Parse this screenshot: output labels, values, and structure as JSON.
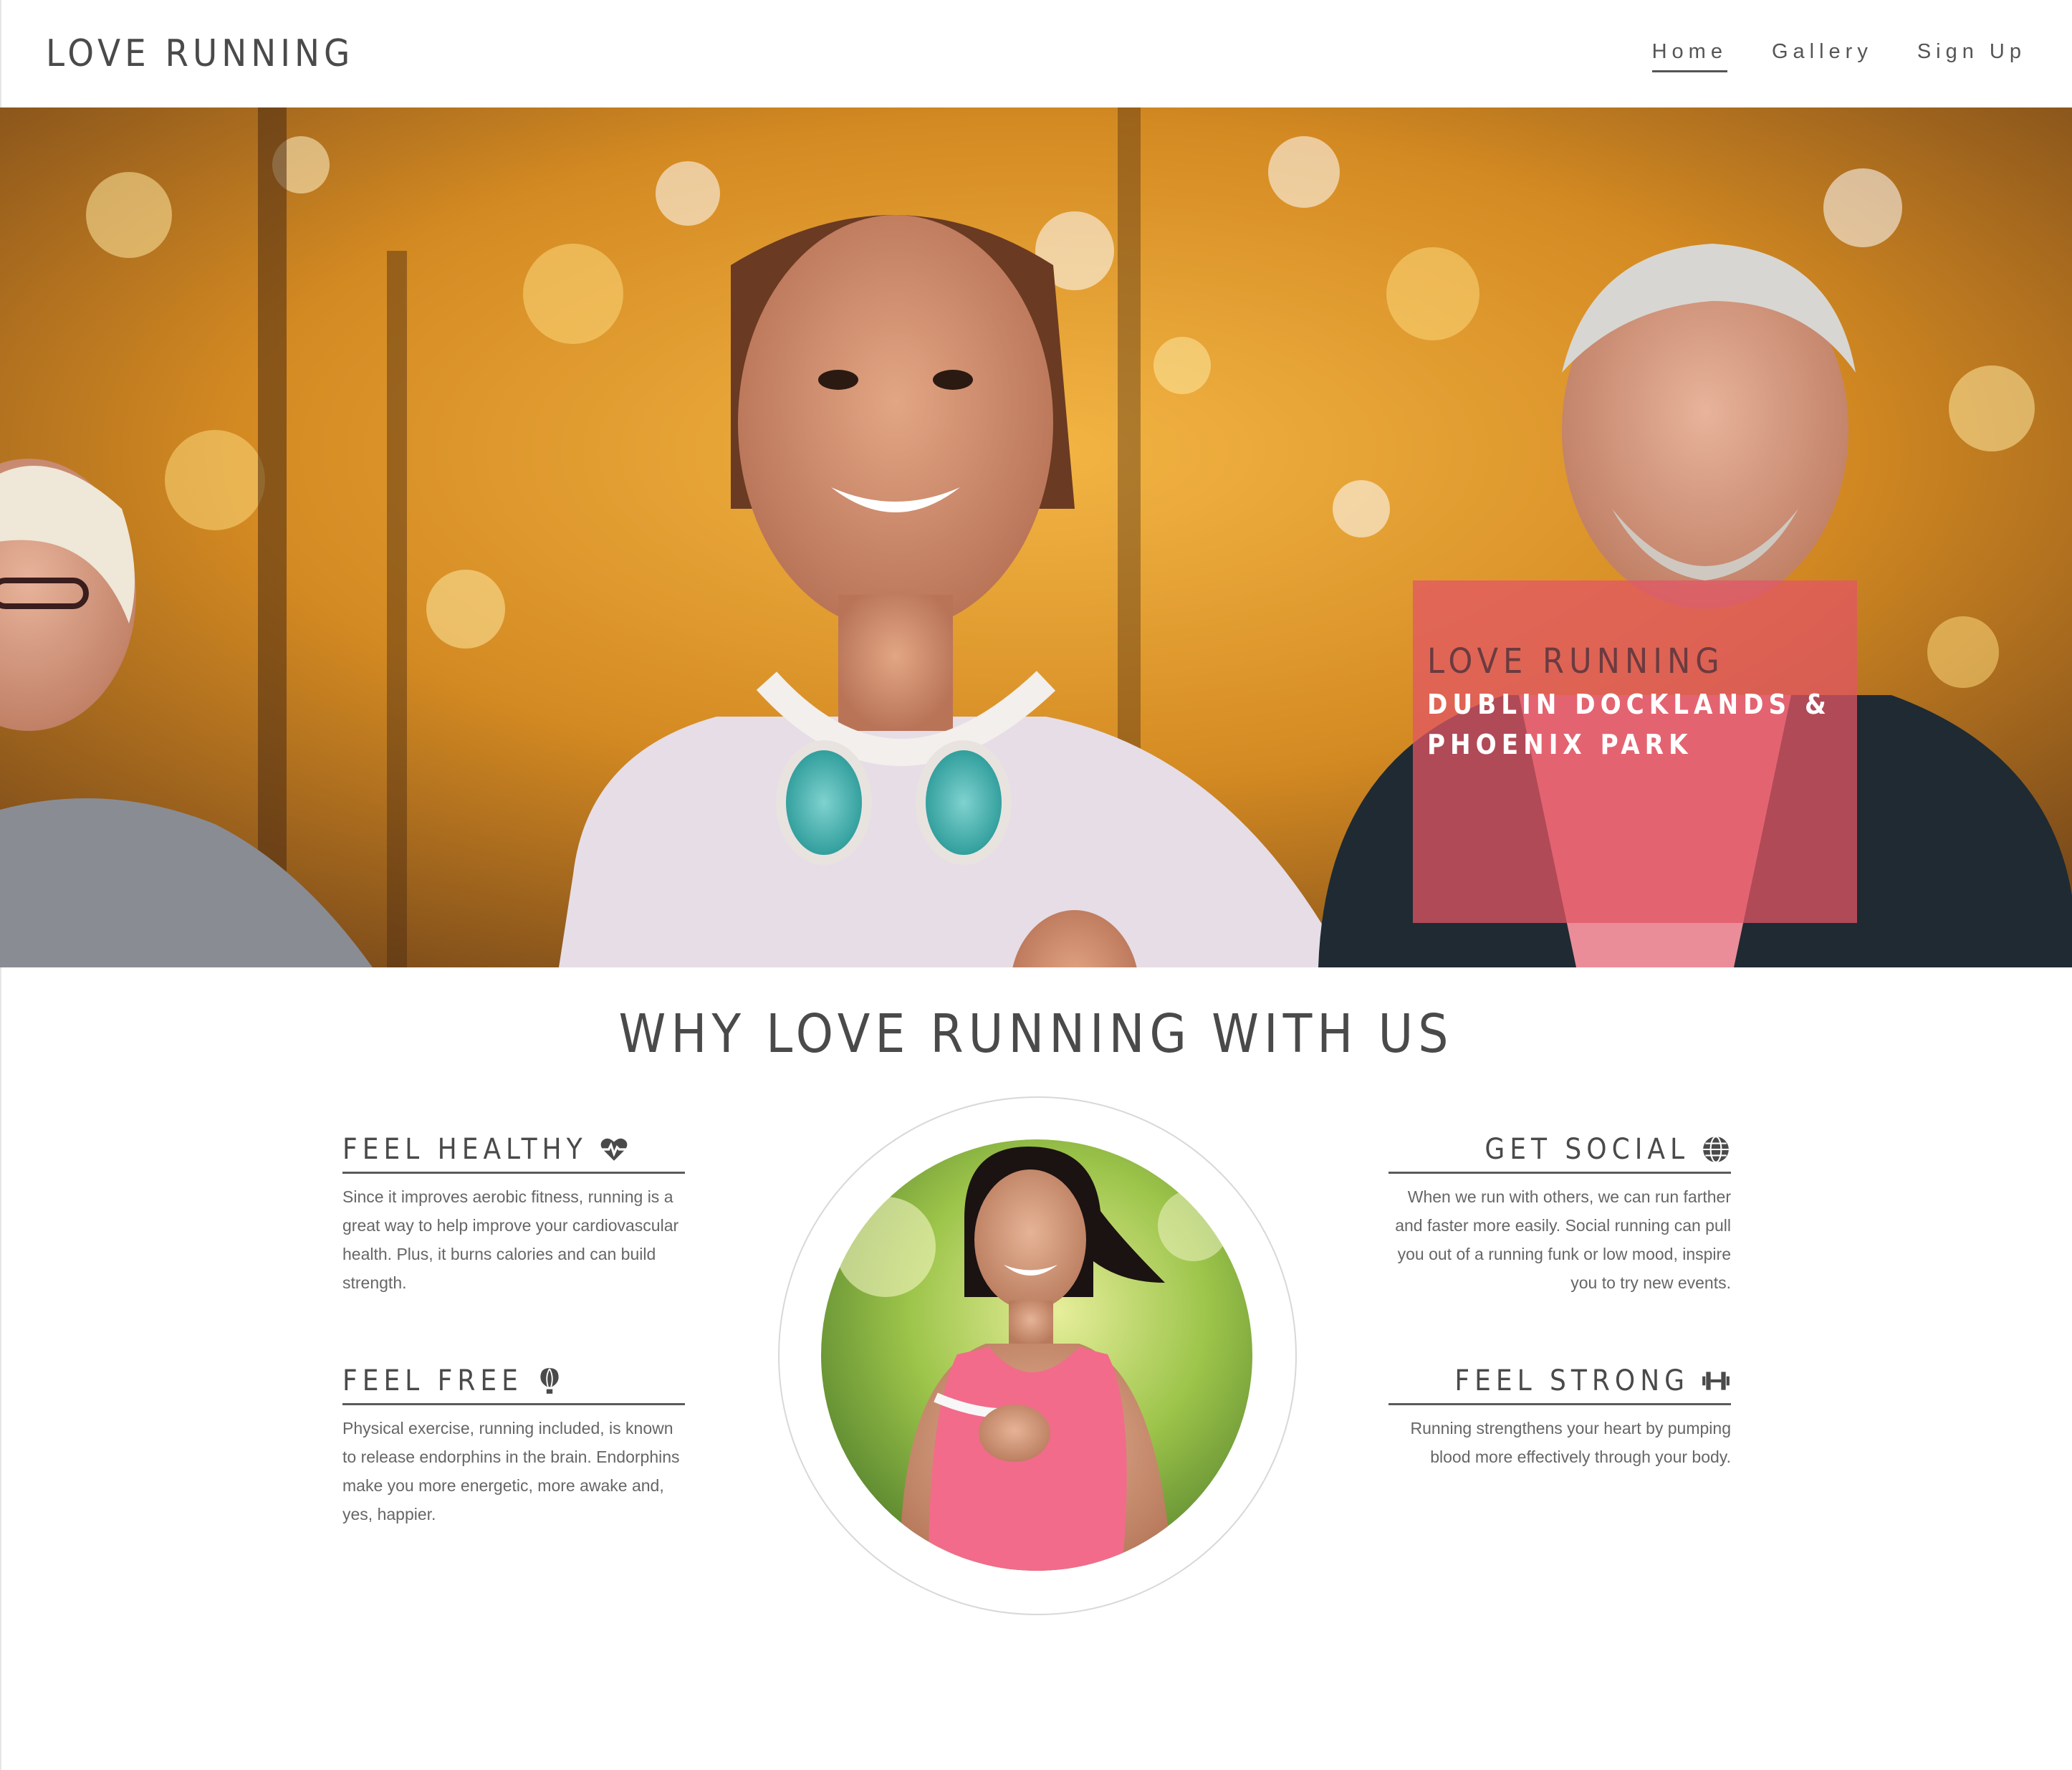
{
  "header": {
    "brand": "LOVE RUNNING",
    "nav": [
      {
        "label": "Home",
        "active": true
      },
      {
        "label": "Gallery",
        "active": false
      },
      {
        "label": "Sign Up",
        "active": false
      }
    ]
  },
  "hero": {
    "title": "LOVE RUNNING",
    "subtitle_line1": "DUBLIN DOCKLANDS &",
    "subtitle_line2": "PHOENIX PARK",
    "box_color": "#e25664"
  },
  "why": {
    "title": "WHY LOVE RUNNING WITH US",
    "features": [
      {
        "title": "FEEL HEALTHY",
        "icon": "heartbeat-icon",
        "text": "Since it improves aerobic fitness, running is a great way to help improve your cardiovascular health. Plus, it burns calories and can build strength."
      },
      {
        "title": "FEEL FREE",
        "icon": "hot-air-balloon-icon",
        "text": "Physical exercise, running included, is known to release endorphins in the brain. Endorphins make you more energetic, more awake and, yes, happier."
      },
      {
        "title": "GET SOCIAL",
        "icon": "globe-icon",
        "text": "When we run with others, we can run farther and faster more easily. Social running can pull you out of a running funk or low mood, inspire you to try new events."
      },
      {
        "title": "FEEL STRONG",
        "icon": "dumbbell-icon",
        "text": "Running strengthens your heart by pumping blood more effectively through your body."
      }
    ]
  },
  "colors": {
    "text_dark": "#4a4a4a",
    "text_body": "#666666",
    "accent": "#e25664"
  }
}
